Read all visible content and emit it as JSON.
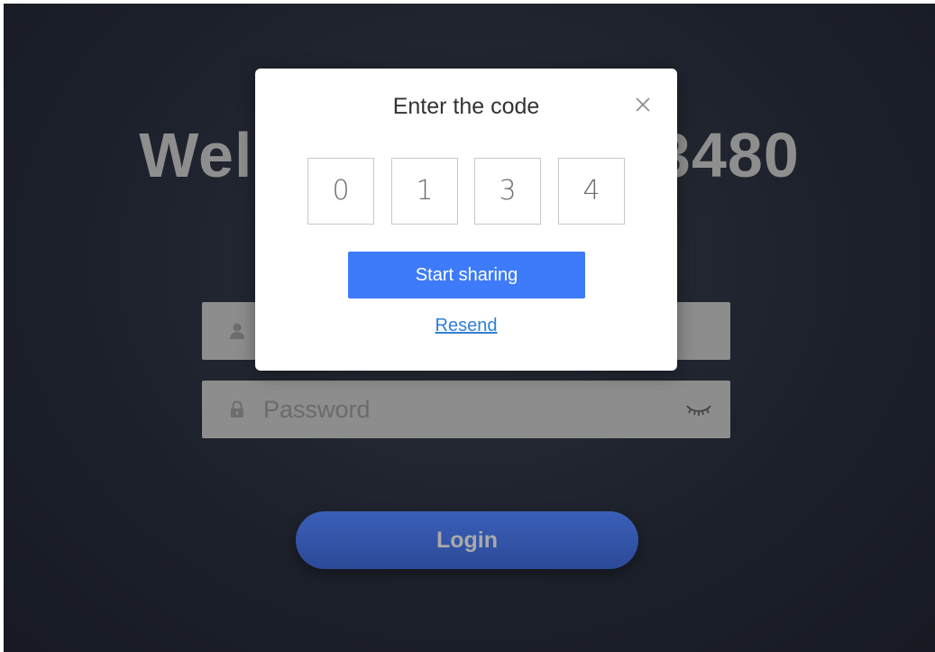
{
  "background": {
    "welcome_text": "Welcome to GXV3480"
  },
  "login_form": {
    "username": {
      "icon": "user-icon",
      "placeholder": ""
    },
    "password": {
      "icon": "lock-icon",
      "placeholder": "Password",
      "toggle_icon": "eye-closed-icon"
    },
    "login_label": "Login"
  },
  "code_dialog": {
    "title": "Enter the code",
    "close_icon": "close-icon",
    "code_digits": [
      "0",
      "1",
      "3",
      "4"
    ],
    "primary_button": "Start sharing",
    "secondary_link": "Resend"
  },
  "colors": {
    "primary_button": "#3e7bfa",
    "link": "#2f7fd6",
    "login_button": "#2c4a98",
    "background": "#1d212b"
  }
}
